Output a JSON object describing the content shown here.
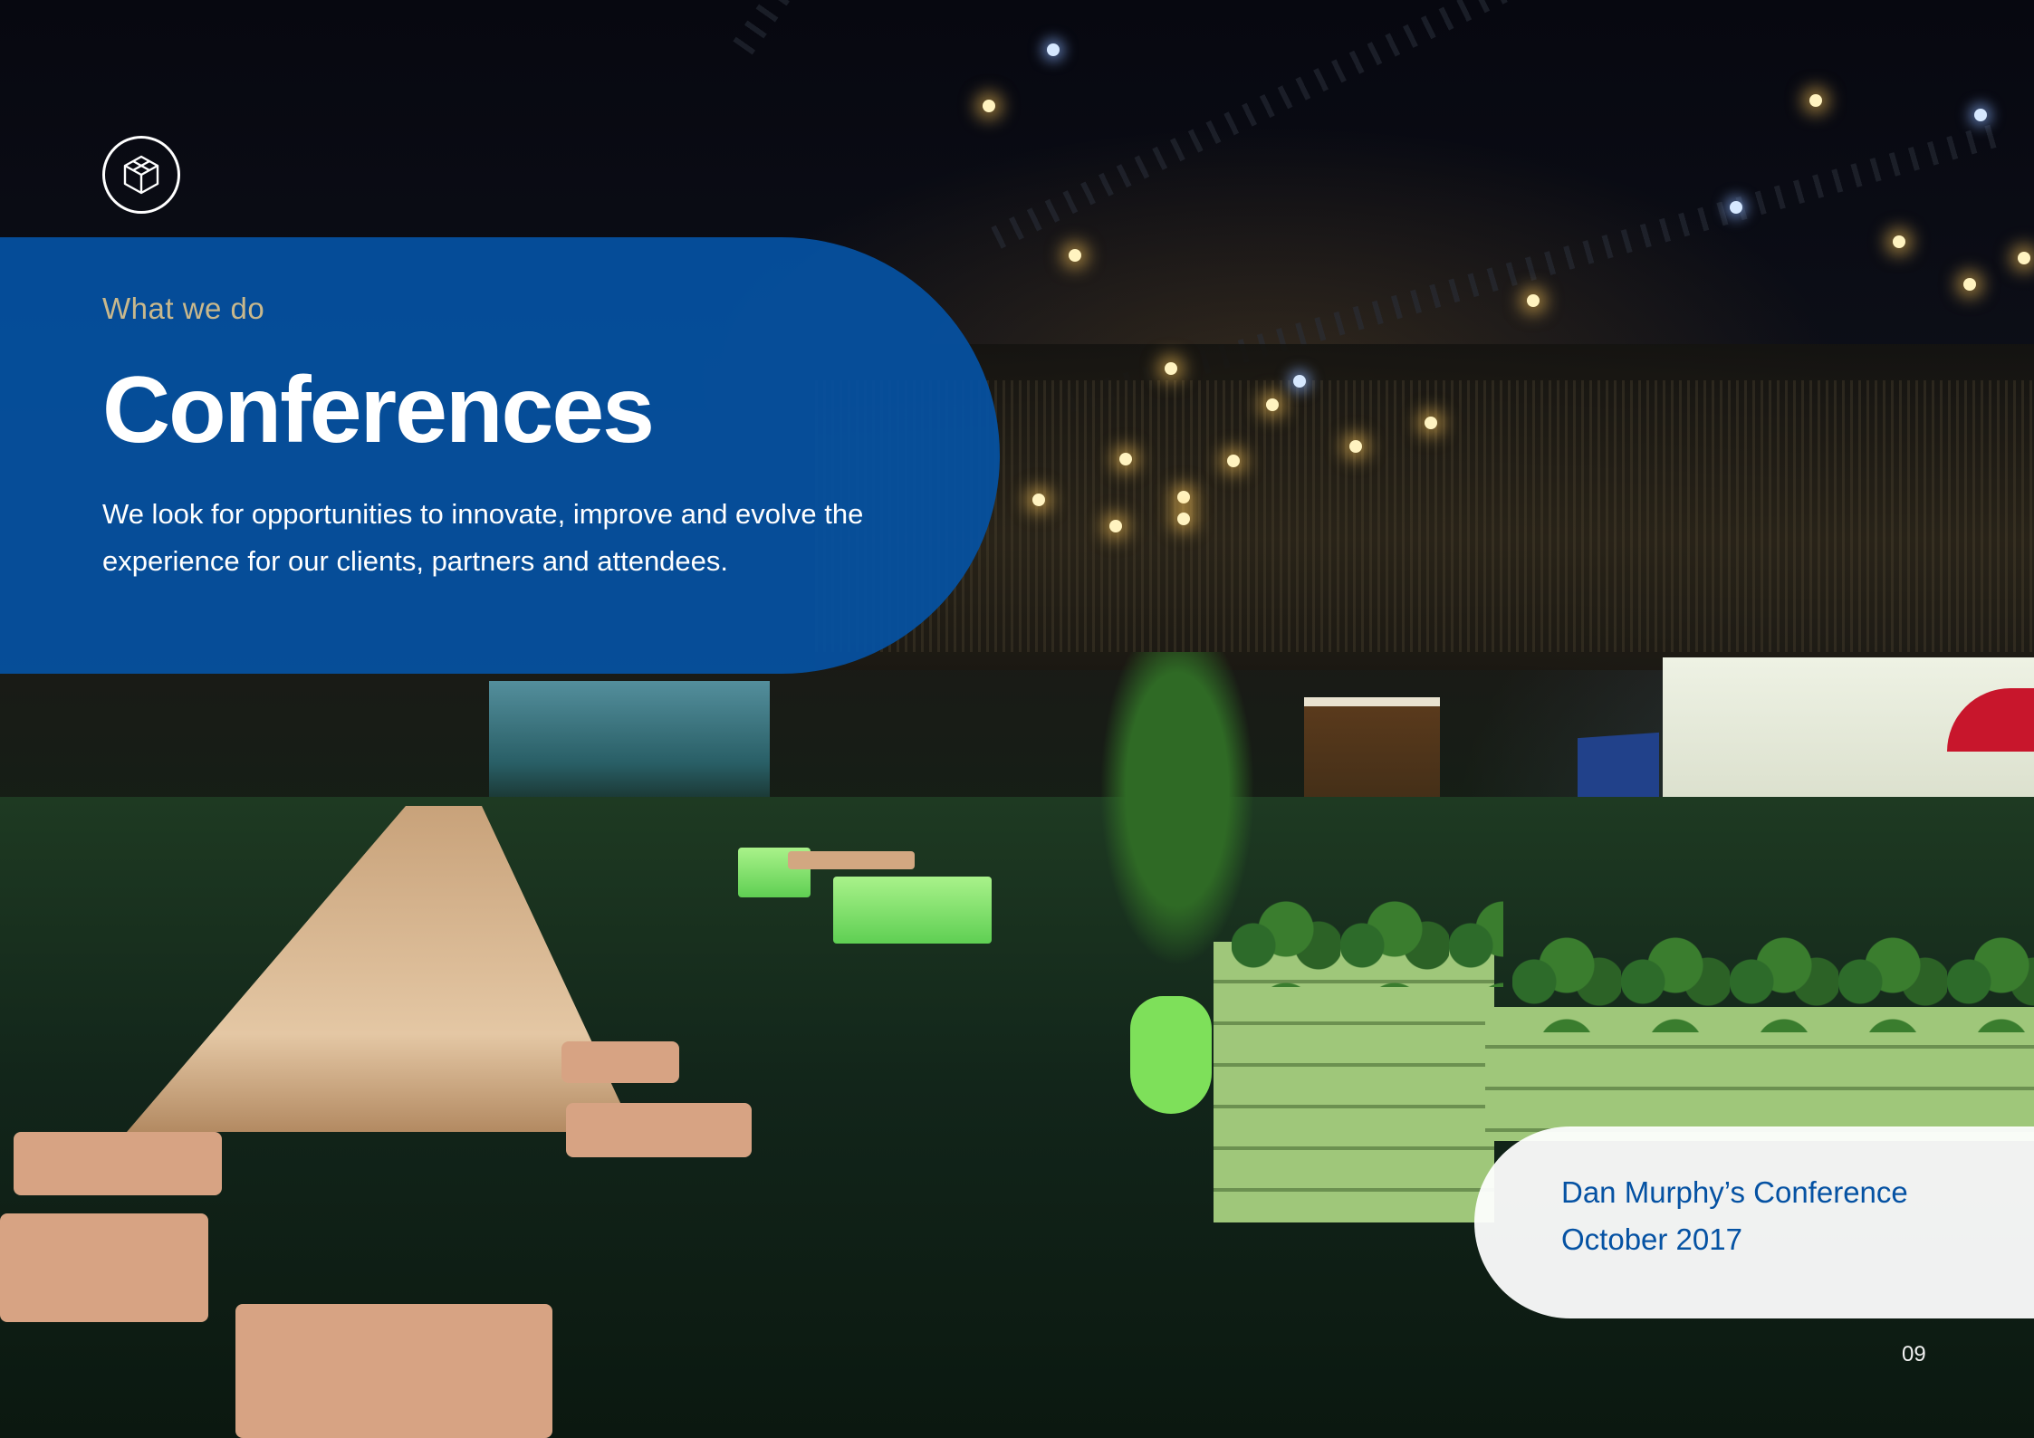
{
  "section": {
    "eyebrow": "What we do",
    "title": "Conferences",
    "intro": "We look for opportunities to innovate, improve and evolve the experience for our clients, partners and attendees."
  },
  "caption": {
    "event_name": "Dan Murphy’s Conference",
    "event_date": "October 2017"
  },
  "footer": {
    "page_number": "09"
  },
  "colors": {
    "panel_blue": "#0552a3",
    "eyebrow_gold": "#c9b88c",
    "caption_text": "#0552a3"
  },
  "icons": {
    "logo": "cube-logo-icon"
  }
}
